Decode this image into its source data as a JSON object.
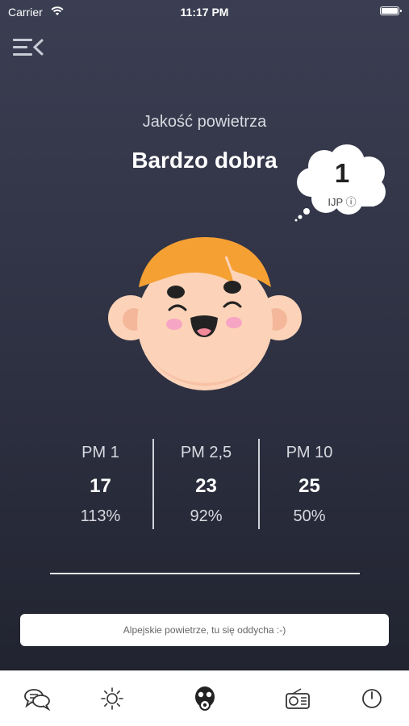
{
  "status": {
    "carrier": "Carrier",
    "time": "11:17 PM"
  },
  "header": {
    "air_quality_label": "Jakość powietrza",
    "quality_value": "Bardzo dobra"
  },
  "index_bubble": {
    "value": "1",
    "label": "IJP ⓘ"
  },
  "pm": [
    {
      "name": "PM 1",
      "value": "17",
      "percent": "113%"
    },
    {
      "name": "PM 2,5",
      "value": "23",
      "percent": "92%"
    },
    {
      "name": "PM 10",
      "value": "25",
      "percent": "50%"
    }
  ],
  "message": "Alpejskie powietrze, tu się oddycha :-)",
  "tabs": [
    "chat-icon",
    "sun-icon",
    "gas-mask-icon",
    "radio-icon",
    "power-icon"
  ],
  "colors": {
    "hair": "#f5a033",
    "skin": "#fcd3b8",
    "cheeks": "#f7a5c4",
    "background": "#2e3142"
  }
}
